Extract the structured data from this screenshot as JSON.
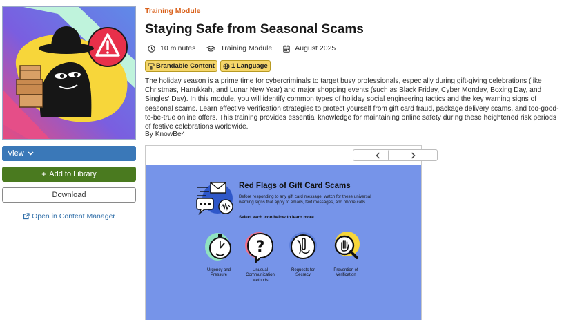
{
  "colors": {
    "accent_orange": "#d9601a",
    "view_button": "#3a78b8",
    "add_button": "#4a7a1f",
    "link": "#2f6ea8",
    "chip": "#f5d66a",
    "slide_bg": "#7694e9"
  },
  "module": {
    "kicker": "Training Module",
    "title": "Staying Safe from Seasonal Scams",
    "meta": {
      "duration": "10 minutes",
      "type": "Training Module",
      "date": "August 2025"
    },
    "chips": {
      "brandable": "Brandable Content",
      "language": "1 Language"
    },
    "description": "The holiday season is a prime time for cybercriminals to target busy professionals, especially during gift-giving celebrations (like Christmas, Hanukkah, and Lunar New Year) and major shopping events (such as Black Friday, Cyber Monday, Boxing Day, and Singles' Day). In this module, you will identify common types of holiday social engineering tactics and the key warning signs of seasonal scams. Learn effective verification strategies to protect yourself from gift card fraud, package delivery scams, and too-good-to-be-true online offers. This training provides essential knowledge for maintaining online safety during these heightened risk periods of festive celebrations worldwide.",
    "byline": "By KnowBe4"
  },
  "actions": {
    "view": "View",
    "add": "Add to Library",
    "download": "Download",
    "open": "Open in Content Manager"
  },
  "preview": {
    "slide_title": "Red Flags of Gift Card Scams",
    "slide_subtitle": "Before responding to any gift card message, watch for these universal warning signs that apply to emails, text messages, and phone calls.",
    "slide_instruction": "Select each icon below to learn more.",
    "cards": [
      {
        "label": "Urgency and Pressure",
        "icon": "stopwatch-icon"
      },
      {
        "label": "Unusual Communication Methods",
        "icon": "question-mark-icon"
      },
      {
        "label": "Requests for Secrecy",
        "icon": "shush-icon"
      },
      {
        "label": "Prevention of Verification",
        "icon": "stop-hand-magnifier-icon"
      }
    ]
  },
  "icons": [
    "clock-icon",
    "graduation-cap-icon",
    "calendar-icon",
    "paint-brush-icon",
    "globe-icon",
    "chevron-down-icon",
    "plus-icon",
    "external-link-icon",
    "chevron-left-icon",
    "chevron-right-icon",
    "warning-icon"
  ]
}
